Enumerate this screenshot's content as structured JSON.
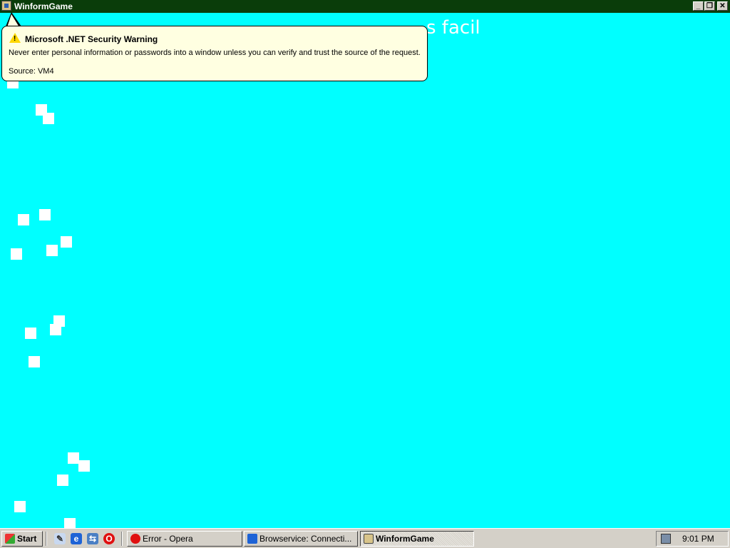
{
  "window": {
    "title": "WinformGame",
    "minimize_glyph": "_",
    "restore_glyph": "❐",
    "close_glyph": "✕"
  },
  "game": {
    "banner_text": "s facil",
    "background_color": "#00ffff",
    "block_color": "#ffffff"
  },
  "balloon": {
    "title": "Microsoft .NET Security Warning",
    "message": "Never enter personal information or passwords into a window unless you can verify and trust the source of the request.",
    "source": "Source: VM4",
    "icon": "warning-icon"
  },
  "taskbar": {
    "start_label": "Start",
    "quick_launch": [
      {
        "name": "show-desktop-icon",
        "glyph": "✎"
      },
      {
        "name": "internet-explorer-icon",
        "glyph": "e"
      },
      {
        "name": "network-icon",
        "glyph": "⇆"
      },
      {
        "name": "opera-icon",
        "glyph": "O"
      }
    ],
    "tasks": [
      {
        "label": "Error - Opera",
        "icon": "opera-icon",
        "active": false
      },
      {
        "label": "Browservice: Connecti...",
        "icon": "internet-explorer-icon",
        "active": false
      },
      {
        "label": "WinformGame",
        "icon": "winform-app-icon",
        "active": true
      }
    ],
    "clock": "9:01 PM"
  }
}
